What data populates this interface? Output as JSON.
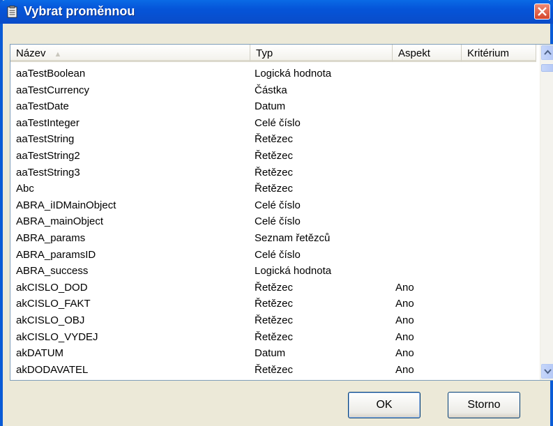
{
  "window": {
    "title": "Vybrat proměnnou"
  },
  "columns": [
    "Název",
    "Typ",
    "Aspekt",
    "Kritérium"
  ],
  "rows": [
    {
      "name": "aaTestBoolean",
      "type": "Logická hodnota",
      "aspect": "",
      "criterion": ""
    },
    {
      "name": "aaTestCurrency",
      "type": "Částka",
      "aspect": "",
      "criterion": ""
    },
    {
      "name": "aaTestDate",
      "type": "Datum",
      "aspect": "",
      "criterion": ""
    },
    {
      "name": "aaTestInteger",
      "type": "Celé číslo",
      "aspect": "",
      "criterion": ""
    },
    {
      "name": "aaTestString",
      "type": "Řetězec",
      "aspect": "",
      "criterion": ""
    },
    {
      "name": "aaTestString2",
      "type": "Řetězec",
      "aspect": "",
      "criterion": ""
    },
    {
      "name": "aaTestString3",
      "type": "Řetězec",
      "aspect": "",
      "criterion": ""
    },
    {
      "name": "Abc",
      "type": "Řetězec",
      "aspect": "",
      "criterion": ""
    },
    {
      "name": "ABRA_iIDMainObject",
      "type": "Celé číslo",
      "aspect": "",
      "criterion": ""
    },
    {
      "name": "ABRA_mainObject",
      "type": "Celé číslo",
      "aspect": "",
      "criterion": ""
    },
    {
      "name": "ABRA_params",
      "type": "Seznam řetězců",
      "aspect": "",
      "criterion": ""
    },
    {
      "name": "ABRA_paramsID",
      "type": "Celé číslo",
      "aspect": "",
      "criterion": ""
    },
    {
      "name": "ABRA_success",
      "type": "Logická hodnota",
      "aspect": "",
      "criterion": ""
    },
    {
      "name": "akCISLO_DOD",
      "type": "Řetězec",
      "aspect": "Ano",
      "criterion": ""
    },
    {
      "name": "akCISLO_FAKT",
      "type": "Řetězec",
      "aspect": "Ano",
      "criterion": ""
    },
    {
      "name": "akCISLO_OBJ",
      "type": "Řetězec",
      "aspect": "Ano",
      "criterion": ""
    },
    {
      "name": "akCISLO_VYDEJ",
      "type": "Řetězec",
      "aspect": "Ano",
      "criterion": ""
    },
    {
      "name": "akDATUM",
      "type": "Datum",
      "aspect": "Ano",
      "criterion": ""
    },
    {
      "name": "akDODAVATEL",
      "type": "Řetězec",
      "aspect": "Ano",
      "criterion": ""
    }
  ],
  "buttons": {
    "ok": "OK",
    "cancel": "Storno"
  },
  "icons": {
    "title": "clipboard-icon",
    "close": "close-icon",
    "sort": "sort-up-icon",
    "scroll_up": "chevron-up-icon",
    "scroll_down": "chevron-down-icon"
  },
  "colors": {
    "titlebar": "#0554D8",
    "close": "#D5452A",
    "face": "#ECE9D8"
  }
}
